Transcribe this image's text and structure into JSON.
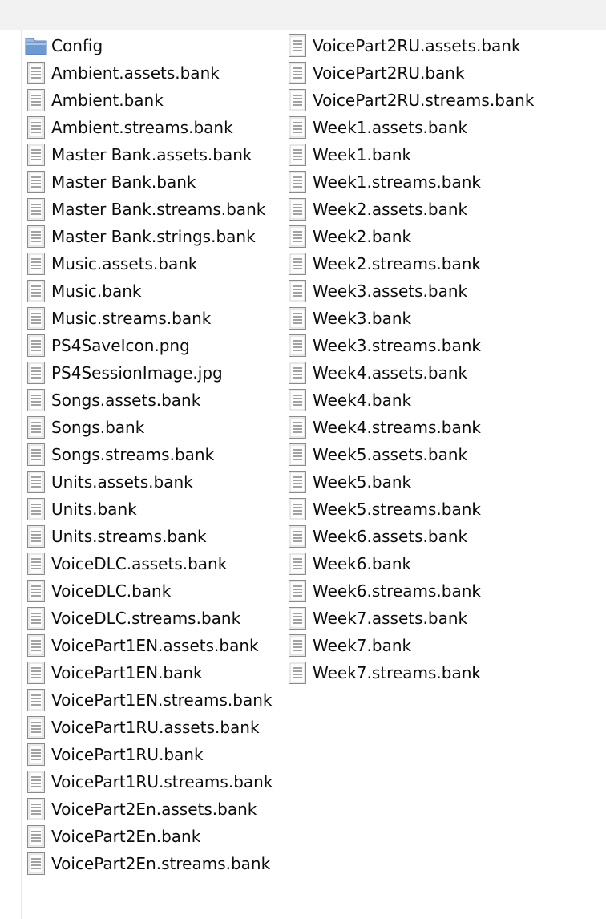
{
  "columns": [
    {
      "items": [
        {
          "label": "Config",
          "icon": "folder-icon"
        },
        {
          "label": "Ambient.assets.bank",
          "icon": "file-icon"
        },
        {
          "label": "Ambient.bank",
          "icon": "file-icon"
        },
        {
          "label": "Ambient.streams.bank",
          "icon": "file-icon"
        },
        {
          "label": "Master Bank.assets.bank",
          "icon": "file-icon"
        },
        {
          "label": "Master Bank.bank",
          "icon": "file-icon"
        },
        {
          "label": "Master Bank.streams.bank",
          "icon": "file-icon"
        },
        {
          "label": "Master Bank.strings.bank",
          "icon": "file-icon"
        },
        {
          "label": "Music.assets.bank",
          "icon": "file-icon"
        },
        {
          "label": "Music.bank",
          "icon": "file-icon"
        },
        {
          "label": "Music.streams.bank",
          "icon": "file-icon"
        },
        {
          "label": "PS4SaveIcon.png",
          "icon": "file-icon"
        },
        {
          "label": "PS4SessionImage.jpg",
          "icon": "file-icon"
        },
        {
          "label": "Songs.assets.bank",
          "icon": "file-icon"
        },
        {
          "label": "Songs.bank",
          "icon": "file-icon"
        },
        {
          "label": "Songs.streams.bank",
          "icon": "file-icon"
        },
        {
          "label": "Units.assets.bank",
          "icon": "file-icon"
        },
        {
          "label": "Units.bank",
          "icon": "file-icon"
        },
        {
          "label": "Units.streams.bank",
          "icon": "file-icon"
        },
        {
          "label": "VoiceDLC.assets.bank",
          "icon": "file-icon"
        },
        {
          "label": "VoiceDLC.bank",
          "icon": "file-icon"
        },
        {
          "label": "VoiceDLC.streams.bank",
          "icon": "file-icon"
        },
        {
          "label": "VoicePart1EN.assets.bank",
          "icon": "file-icon"
        },
        {
          "label": "VoicePart1EN.bank",
          "icon": "file-icon"
        },
        {
          "label": "VoicePart1EN.streams.bank",
          "icon": "file-icon"
        },
        {
          "label": "VoicePart1RU.assets.bank",
          "icon": "file-icon"
        },
        {
          "label": "VoicePart1RU.bank",
          "icon": "file-icon"
        },
        {
          "label": "VoicePart1RU.streams.bank",
          "icon": "file-icon"
        },
        {
          "label": "VoicePart2En.assets.bank",
          "icon": "file-icon"
        },
        {
          "label": "VoicePart2En.bank",
          "icon": "file-icon"
        },
        {
          "label": "VoicePart2En.streams.bank",
          "icon": "file-icon"
        }
      ]
    },
    {
      "items": [
        {
          "label": "VoicePart2RU.assets.bank",
          "icon": "file-icon"
        },
        {
          "label": "VoicePart2RU.bank",
          "icon": "file-icon"
        },
        {
          "label": "VoicePart2RU.streams.bank",
          "icon": "file-icon"
        },
        {
          "label": "Week1.assets.bank",
          "icon": "file-icon"
        },
        {
          "label": "Week1.bank",
          "icon": "file-icon"
        },
        {
          "label": "Week1.streams.bank",
          "icon": "file-icon"
        },
        {
          "label": "Week2.assets.bank",
          "icon": "file-icon"
        },
        {
          "label": "Week2.bank",
          "icon": "file-icon"
        },
        {
          "label": "Week2.streams.bank",
          "icon": "file-icon"
        },
        {
          "label": "Week3.assets.bank",
          "icon": "file-icon"
        },
        {
          "label": "Week3.bank",
          "icon": "file-icon"
        },
        {
          "label": "Week3.streams.bank",
          "icon": "file-icon"
        },
        {
          "label": "Week4.assets.bank",
          "icon": "file-icon"
        },
        {
          "label": "Week4.bank",
          "icon": "file-icon"
        },
        {
          "label": "Week4.streams.bank",
          "icon": "file-icon"
        },
        {
          "label": "Week5.assets.bank",
          "icon": "file-icon"
        },
        {
          "label": "Week5.bank",
          "icon": "file-icon"
        },
        {
          "label": "Week5.streams.bank",
          "icon": "file-icon"
        },
        {
          "label": "Week6.assets.bank",
          "icon": "file-icon"
        },
        {
          "label": "Week6.bank",
          "icon": "file-icon"
        },
        {
          "label": "Week6.streams.bank",
          "icon": "file-icon"
        },
        {
          "label": "Week7.assets.bank",
          "icon": "file-icon"
        },
        {
          "label": "Week7.bank",
          "icon": "file-icon"
        },
        {
          "label": "Week7.streams.bank",
          "icon": "file-icon"
        }
      ]
    }
  ],
  "colors": {
    "toolbar_bg": "#f2f2f2",
    "folder_blue": "#6d9ad3",
    "file_outline": "#8a8a8a",
    "text": "#0c0c0c"
  }
}
